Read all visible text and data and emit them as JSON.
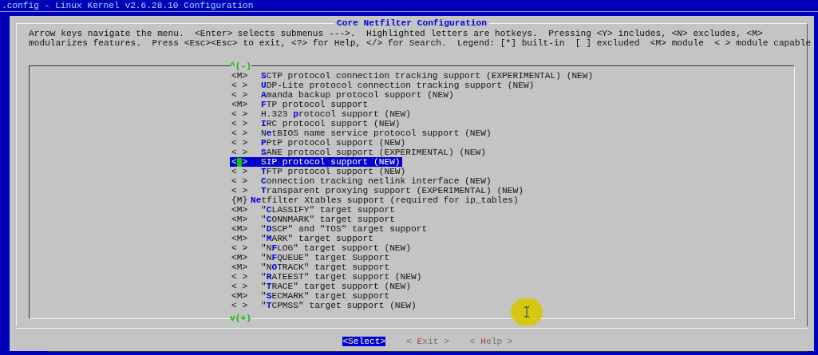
{
  "window": {
    "title": ".config - Linux Kernel v2.6.28.10 Configuration"
  },
  "dialog": {
    "title": "Core Netfilter Configuration",
    "help": [
      "Arrow keys navigate the menu.  <Enter> selects submenus --->.  Highlighted letters are hotkeys.  Pressing <Y> includes, <N> excludes, <M>",
      "modularizes features.  Press <Esc><Esc> to exit, <?> for Help, </> for Search.  Legend: [*] built-in  [ ] excluded  <M> module  < > module capable"
    ]
  },
  "menu": {
    "scroll_up": "^(-)",
    "scroll_down": "v(+)",
    "items": [
      {
        "kind": "option",
        "state": "<M>",
        "hotkey": "S",
        "after": "CTP protocol connection tracking support (EXPERIMENTAL) (NEW)",
        "selected": false
      },
      {
        "kind": "option",
        "state": "< >",
        "hotkey": "U",
        "after": "DP-Lite protocol connection tracking support (NEW)",
        "selected": false
      },
      {
        "kind": "option",
        "state": "< >",
        "hotkey": "A",
        "after": "manda backup protocol support (NEW)",
        "selected": false
      },
      {
        "kind": "option",
        "state": "<M>",
        "hotkey": "F",
        "after": "TP protocol support",
        "selected": false
      },
      {
        "kind": "option",
        "state": "< >",
        "before": "H.323 ",
        "hotkey": "p",
        "after": "rotocol support (NEW)",
        "selected": false
      },
      {
        "kind": "option",
        "state": "< >",
        "hotkey": "I",
        "after": "RC protocol support (NEW)",
        "selected": false
      },
      {
        "kind": "option",
        "state": "< >",
        "before": "N",
        "hotkey": "e",
        "after": "tBIOS name service protocol support (NEW)",
        "selected": false
      },
      {
        "kind": "option",
        "state": "< >",
        "hotkey": "P",
        "after": "PtP protocol support (NEW)",
        "selected": false
      },
      {
        "kind": "option",
        "state": "< >",
        "hotkey": "S",
        "after": "ANE protocol support (EXPERIMENTAL) (NEW)",
        "selected": false
      },
      {
        "kind": "option",
        "state": "< >",
        "hotkey": "S",
        "after": "IP protocol support (NEW)",
        "selected": true
      },
      {
        "kind": "option",
        "state": "< >",
        "hotkey": "T",
        "after": "FTP protocol support (NEW)",
        "selected": false
      },
      {
        "kind": "option",
        "state": "< >",
        "hotkey": "C",
        "after": "onnection tracking netlink interface (NEW)",
        "selected": false
      },
      {
        "kind": "option",
        "state": "< >",
        "hotkey": "T",
        "after": "ransparent proxying support (EXPERIMENTAL) (NEW)",
        "selected": false
      },
      {
        "kind": "menu",
        "state": "{M}",
        "hotkey": "Ne",
        "after": "tfilter Xtables support (required for ip_tables)",
        "selected": false
      },
      {
        "kind": "option",
        "state": "<M>",
        "before": "\"",
        "hotkey": "C",
        "after": "LASSIFY\" target support",
        "selected": false
      },
      {
        "kind": "option",
        "state": "<M>",
        "before": "\"",
        "hotkey": "C",
        "after": "ONNMARK\" target support",
        "selected": false
      },
      {
        "kind": "option",
        "state": "<M>",
        "before": "\"",
        "hotkey": "D",
        "after": "SCP\" and \"TOS\" target support",
        "selected": false
      },
      {
        "kind": "option",
        "state": "<M>",
        "before": "\"",
        "hotkey": "M",
        "after": "ARK\" target support",
        "selected": false
      },
      {
        "kind": "option",
        "state": "< >",
        "before": "\"N",
        "hotkey": "F",
        "after": "LOG\" target support (NEW)",
        "selected": false
      },
      {
        "kind": "option",
        "state": "<M>",
        "before": "\"N",
        "hotkey": "F",
        "after": "QUEUE\" target Support",
        "selected": false
      },
      {
        "kind": "option",
        "state": "<M>",
        "before": "\"N",
        "hotkey": "O",
        "after": "TRACK\" target support",
        "selected": false
      },
      {
        "kind": "option",
        "state": "< >",
        "before": "\"",
        "hotkey": "R",
        "after": "ATEEST\" target support (NEW)",
        "selected": false
      },
      {
        "kind": "option",
        "state": "< >",
        "before": "\"",
        "hotkey": "T",
        "after": "RACE\" target support (NEW)",
        "selected": false
      },
      {
        "kind": "option",
        "state": "<M>",
        "before": "\"",
        "hotkey": "S",
        "after": "ECMARK\" target support",
        "selected": false
      },
      {
        "kind": "option",
        "state": "< >",
        "before": "\"",
        "hotkey": "T",
        "after": "CPMSS\" target support (NEW)",
        "selected": false
      }
    ]
  },
  "buttons": [
    {
      "before": "<",
      "hotkey": "S",
      "after": "elect>",
      "selected": true
    },
    {
      "before": "< ",
      "hotkey": "E",
      "after": "xit >",
      "selected": false
    },
    {
      "before": "< ",
      "hotkey": "H",
      "after": "elp >",
      "selected": false
    }
  ]
}
